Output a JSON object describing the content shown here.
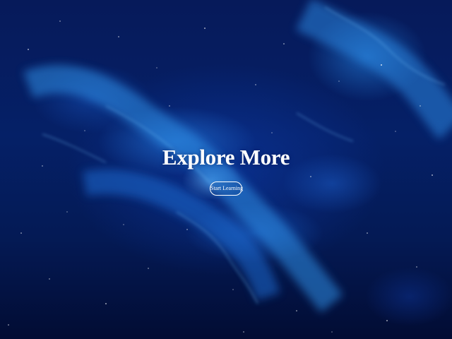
{
  "hero": {
    "title": "Explore More",
    "cta_label": "Start Learning",
    "background": "space-nebula-image"
  },
  "colors": {
    "background_deep": "#03103a",
    "nebula_blue": "#1e6edc",
    "nebula_glow": "#6ebeff",
    "text": "#ffffff"
  }
}
